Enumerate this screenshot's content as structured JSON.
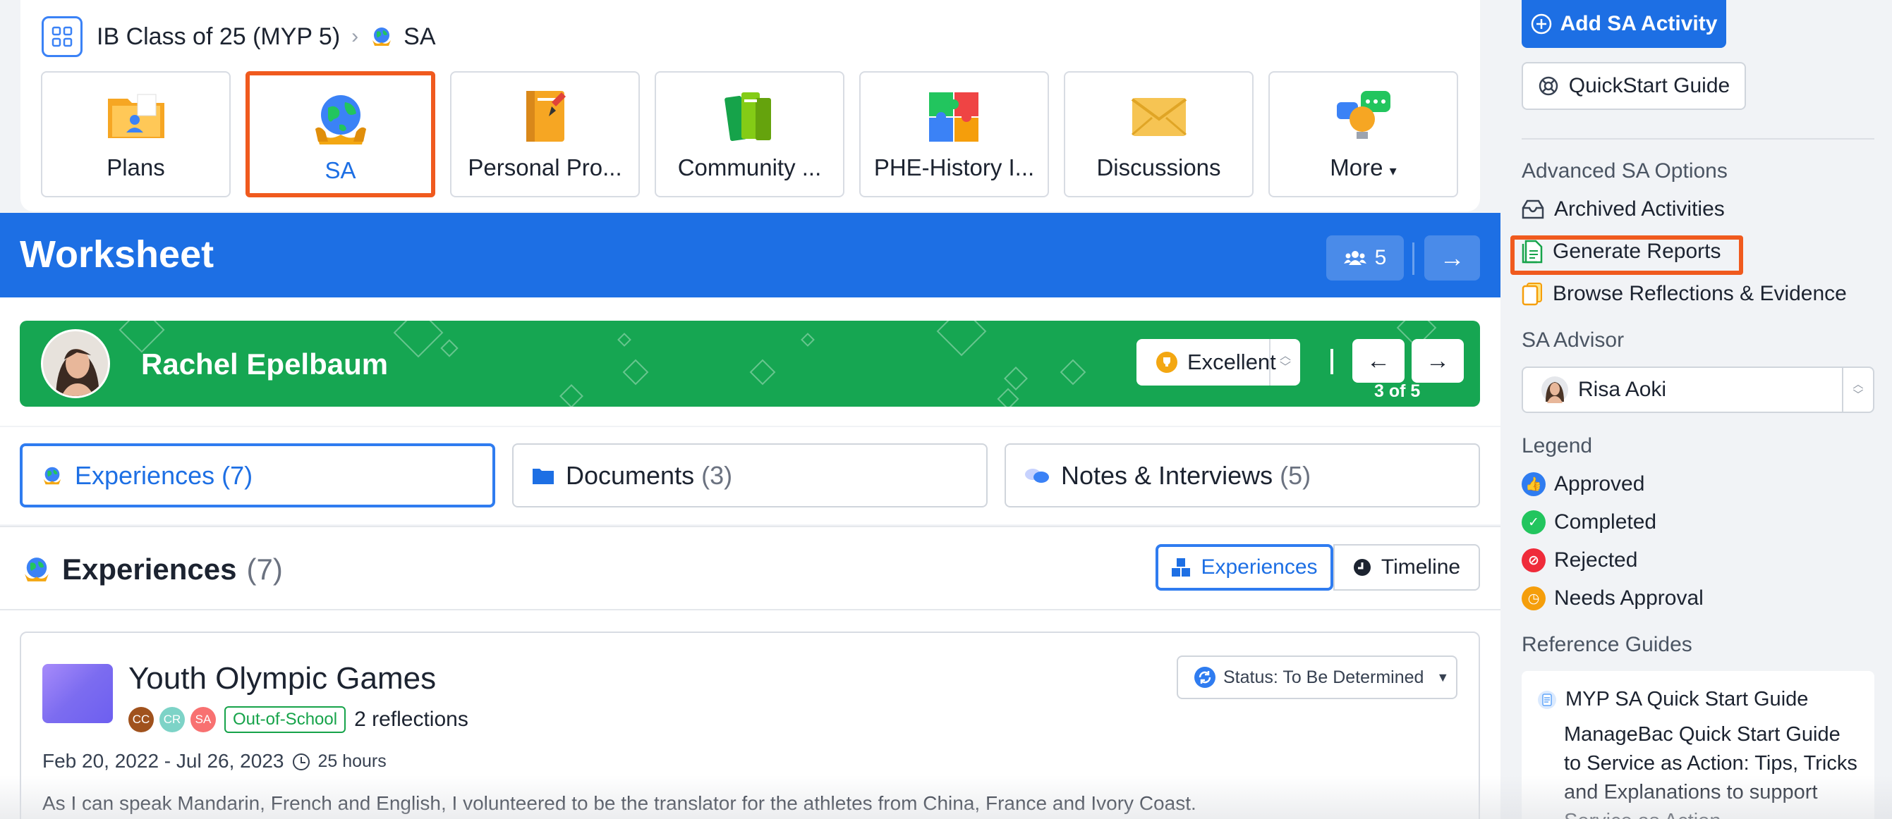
{
  "breadcrumb": {
    "class_name": "IB Class of 25 (MYP 5)",
    "section": "SA"
  },
  "tiles": [
    {
      "label": "Plans",
      "icon": "folder-icon"
    },
    {
      "label": "SA",
      "icon": "globe-icon",
      "active": true
    },
    {
      "label": "Personal Pro...",
      "icon": "notebook-icon"
    },
    {
      "label": "Community ...",
      "icon": "books-icon"
    },
    {
      "label": "PHE-History I...",
      "icon": "puzzle-icon"
    },
    {
      "label": "Discussions",
      "icon": "envelope-icon"
    },
    {
      "label": "More",
      "icon": "lightbulb-chat-icon"
    }
  ],
  "worksheet": {
    "title": "Worksheet",
    "member_count": "5"
  },
  "student": {
    "name": "Rachel Epelbaum",
    "grade": "Excellent",
    "position": "3 of 5"
  },
  "tabs": [
    {
      "label": "Experiences",
      "count": "(7)",
      "active": true
    },
    {
      "label": "Documents",
      "count": "(3)"
    },
    {
      "label": "Notes & Interviews",
      "count": "(5)"
    }
  ],
  "section": {
    "title": "Experiences",
    "count": "(7)",
    "view_experiences": "Experiences",
    "view_timeline": "Timeline"
  },
  "experience": {
    "title": "Youth Olympic Games",
    "participants": [
      "CC",
      "CR",
      "SA"
    ],
    "tag": "Out-of-School",
    "reflections": "2 reflections",
    "dates": "Feb 20, 2022 - Jul 26, 2023",
    "hours": "25 hours",
    "description": "As I can speak Mandarin, French and English, I volunteered to be the translator for the athletes from China, France and Ivory Coast.",
    "status": "Status: To Be Determined"
  },
  "sidebar": {
    "add_button": "Add SA Activity",
    "quickstart_button": "QuickStart Guide",
    "advanced_heading": "Advanced SA Options",
    "archived": "Archived Activities",
    "generate_reports": "Generate Reports",
    "browse": "Browse Reflections & Evidence",
    "advisor_heading": "SA Advisor",
    "advisor_name": "Risa Aoki",
    "legend_heading": "Legend",
    "legend": [
      {
        "label": "Approved",
        "color": "#2f7cf0",
        "icon": "thumbs-up-icon"
      },
      {
        "label": "Completed",
        "color": "#22c55e",
        "icon": "check-icon"
      },
      {
        "label": "Rejected",
        "color": "#ef2b3a",
        "icon": "ban-icon"
      },
      {
        "label": "Needs Approval",
        "color": "#f59e0b",
        "icon": "clock-icon"
      }
    ],
    "guides_heading": "Reference Guides",
    "guide_title": "MYP SA Quick Start Guide",
    "guide_desc": "ManageBac Quick Start Guide to Service as Action: Tips, Tricks and Explanations to support Service as Action"
  },
  "colors": {
    "primary": "#1d6fe4",
    "student_banner": "#16a652",
    "highlight": "#f05a1e"
  }
}
